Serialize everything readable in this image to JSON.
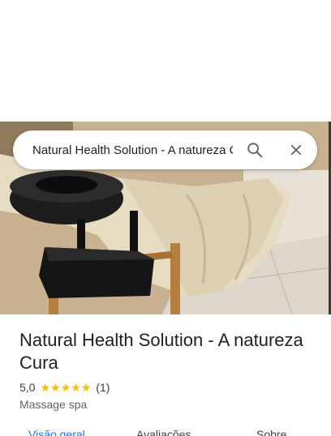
{
  "search": {
    "value": "Natural Health Solution - A natureza Cura"
  },
  "place": {
    "name": "Natural Health Solution - A natureza Cura",
    "rating": "5,0",
    "stars": 5,
    "review_count": "(1)",
    "category": "Massage spa"
  },
  "tabs": [
    {
      "label": "Visão geral",
      "active": true
    },
    {
      "label": "Avaliações",
      "active": false
    },
    {
      "label": "Sobre",
      "active": false
    }
  ],
  "icons": {
    "search": "search-icon",
    "close": "close-icon",
    "star": "star-icon"
  },
  "colors": {
    "accent": "#1a73e8",
    "star": "#fbbc04"
  }
}
